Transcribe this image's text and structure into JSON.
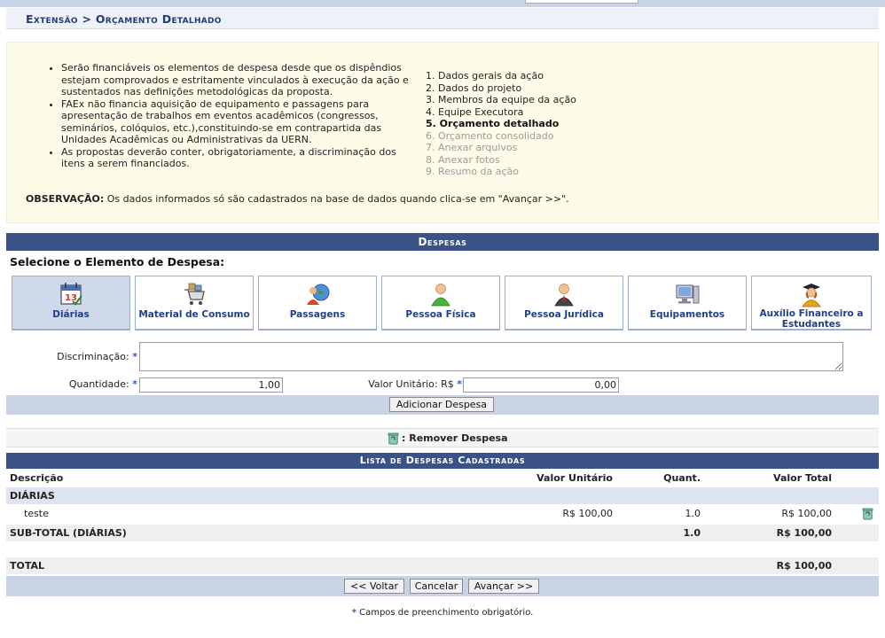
{
  "breadcrumb": "Extensão > Orçamento Detalhado",
  "info": {
    "bullets": [
      "Serão financiáveis os elementos de despesa desde que os dispêndios estejam comprovados e estritamente vinculados à execução da ação e sustentados nas definições metodológicas da proposta.",
      "FAEx não financia aquisição de equipamento e passagens para apresentação de trabalhos em eventos acadêmicos (congressos, seminários, colóquios, etc.),constituindo-se em contrapartida das Unidades Acadêmicas ou Administrativas da UERN.",
      "As propostas deverão conter, obrigatoriamente, a discriminação dos itens a serem financiados."
    ],
    "steps": [
      {
        "label": "1. Dados gerais da ação",
        "state": "done"
      },
      {
        "label": "2. Dados do projeto",
        "state": "done"
      },
      {
        "label": "3. Membros da equipe da ação",
        "state": "done"
      },
      {
        "label": "4. Equipe Executora",
        "state": "done"
      },
      {
        "label": "5. Orçamento detalhado",
        "state": "current"
      },
      {
        "label": "6. Orçamento consolidado",
        "state": "pending"
      },
      {
        "label": "7. Anexar arquivos",
        "state": "pending"
      },
      {
        "label": "8. Anexar fotos",
        "state": "pending"
      },
      {
        "label": "9. Resumo da ação",
        "state": "pending"
      }
    ],
    "obs_label": "OBSERVAÇÃO:",
    "obs_text": " Os dados informados só são cadastrados na base de dados quando clica-se em \"Avançar >>\"."
  },
  "despesas": {
    "caption": "Despesas",
    "select_title": "Selecione o Elemento de Despesa:",
    "types": [
      {
        "label": "Diárias",
        "icon": "calendar-icon",
        "selected": true
      },
      {
        "label": "Material de Consumo",
        "icon": "cart-icon",
        "selected": false
      },
      {
        "label": "Passagens",
        "icon": "globe-person-icon",
        "selected": false
      },
      {
        "label": "Pessoa Física",
        "icon": "person-icon",
        "selected": false
      },
      {
        "label": "Pessoa Jurídica",
        "icon": "businessman-icon",
        "selected": false
      },
      {
        "label": "Equipamentos",
        "icon": "computer-icon",
        "selected": false
      },
      {
        "label": "Auxílio Financeiro a Estudantes",
        "icon": "graduate-icon",
        "selected": false
      }
    ],
    "discriminacao_label": "Discriminação:",
    "discriminacao_value": "",
    "quantidade_label": "Quantidade:",
    "quantidade_value": "1,00",
    "valor_unitario_label": "Valor Unitário: R$",
    "valor_unitario_value": "0,00",
    "add_button": "Adicionar Despesa"
  },
  "remove_legend": ": Remover Despesa",
  "lista": {
    "caption": "Lista de Despesas Cadastradas",
    "headers": {
      "descricao": "Descrição",
      "valor_unitario": "Valor Unitário",
      "quant": "Quant.",
      "valor_total": "Valor Total"
    },
    "group": "DIÁRIAS",
    "item": {
      "descricao": "teste",
      "valor_unitario": "R$ 100,00",
      "quant": "1.0",
      "valor_total": "R$ 100,00"
    },
    "subtotal": {
      "label": "SUB-TOTAL (DIÁRIAS)",
      "quant": "1.0",
      "valor_total": "R$ 100,00"
    },
    "total": {
      "label": "TOTAL",
      "valor_total": "R$ 100,00"
    }
  },
  "nav": {
    "voltar": "<< Voltar",
    "cancelar": "Cancelar",
    "avancar": "Avançar >>"
  },
  "footer": {
    "star": "*",
    "text": " Campos de preenchimento obrigatório."
  }
}
